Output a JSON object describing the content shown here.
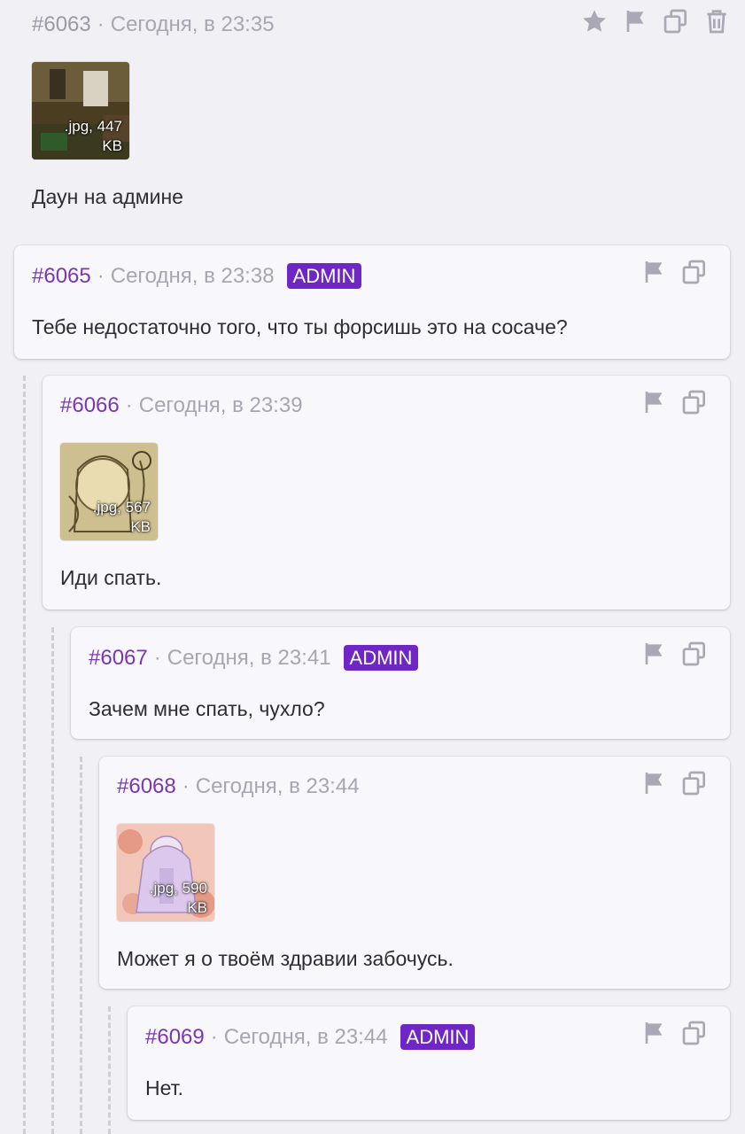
{
  "posts": [
    {
      "num": "#6063",
      "time": "Сегодня, в 23:35",
      "attachment": {
        "caption_line1": ".jpg, 447",
        "caption_line2": "KB"
      },
      "text": "Даун на админе"
    },
    {
      "num": "#6065",
      "time": "Сегодня, в 23:38",
      "badge": "ADMIN",
      "text": "Тебе недостаточно того, что ты форсишь это на сосаче?"
    },
    {
      "num": "#6066",
      "time": "Сегодня, в 23:39",
      "attachment": {
        "caption_line1": ".jpg, 567",
        "caption_line2": "KB"
      },
      "text": "Иди спать."
    },
    {
      "num": "#6067",
      "time": "Сегодня, в 23:41",
      "badge": "ADMIN",
      "text": "Зачем мне спать, чухло?"
    },
    {
      "num": "#6068",
      "time": "Сегодня, в 23:44",
      "attachment": {
        "caption_line1": ".jpg, 590",
        "caption_line2": "KB"
      },
      "text": "Может я о твоём здравии забочусь."
    },
    {
      "num": "#6069",
      "time": "Сегодня, в 23:44",
      "badge": "ADMIN",
      "text": "Нет."
    }
  ],
  "separator": "·",
  "colors": {
    "post_number": "#7a36b8",
    "admin_badge": "#6e27c5",
    "background": "#f1f0f5",
    "card": "#f8f7fb"
  },
  "icons": [
    "star-icon",
    "flag-icon",
    "copy-icon",
    "trash-icon"
  ]
}
